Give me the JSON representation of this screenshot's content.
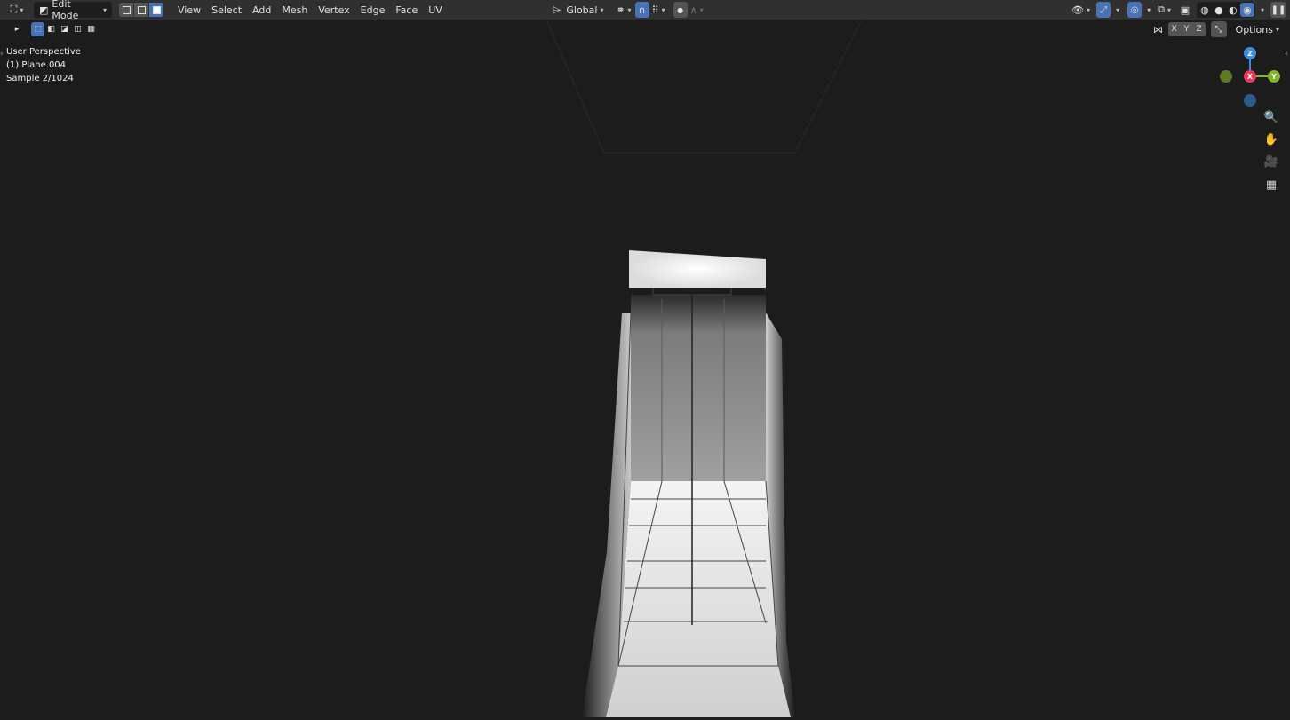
{
  "header": {
    "mode_label": "Edit Mode",
    "menus": [
      "View",
      "Select",
      "Add",
      "Mesh",
      "Vertex",
      "Edge",
      "Face",
      "UV"
    ],
    "transform_orientation": "Global",
    "options_label": "Options"
  },
  "viewport_info": {
    "line1": "User Perspective",
    "line2": "(1) Plane.004",
    "line3": "Sample 2/1024"
  },
  "axes": {
    "x_label": "X",
    "y_label": "Y",
    "z_label": "Z",
    "x_color": "#ee3a58",
    "y_color": "#7fb62a",
    "z_color": "#3f8bdc",
    "neg_y_color": "#5c7a25",
    "neg_z_color": "#2f5a8c"
  },
  "mirror_axes": [
    "X",
    "Y",
    "Z"
  ],
  "colors": {
    "accent": "#4772b3",
    "header_bg": "#303030",
    "viewport_bg": "#1c1c1c"
  }
}
